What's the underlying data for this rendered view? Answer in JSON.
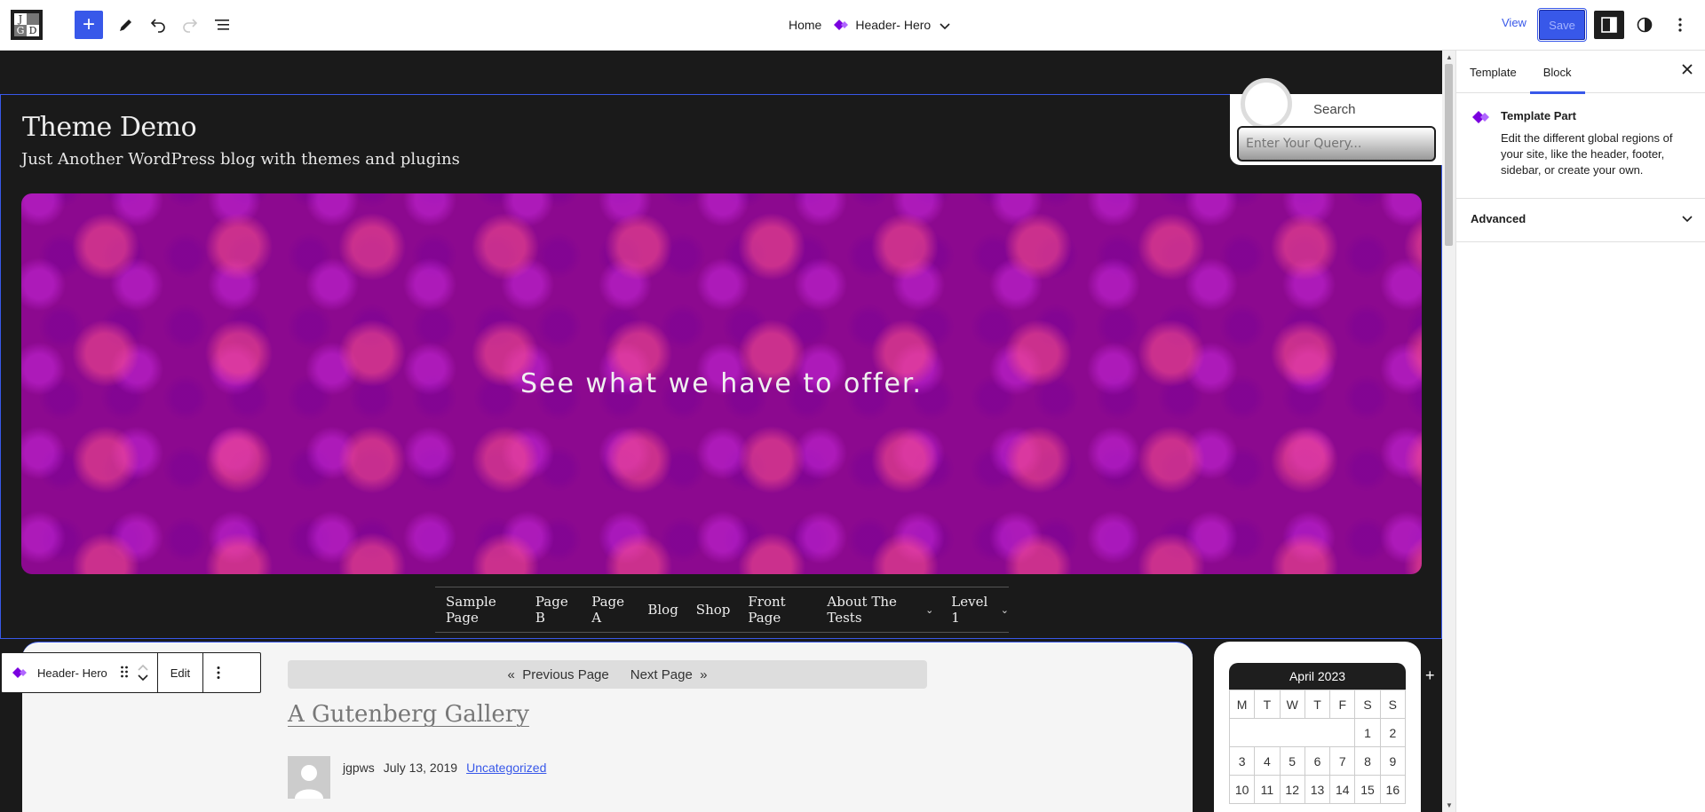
{
  "logo": {
    "letters": [
      "J",
      "",
      "G",
      "D"
    ]
  },
  "breadcrumb": {
    "home": "Home",
    "current": "Header- Hero"
  },
  "toolbar": {
    "view_label": "View",
    "save_label": "Save"
  },
  "site": {
    "title": "Theme Demo",
    "tagline": "Just Another WordPress blog with themes and plugins"
  },
  "search": {
    "label": "Search",
    "placeholder": "Enter Your Query..."
  },
  "hero": {
    "text": "See what we have to offer."
  },
  "nav": {
    "items": [
      "Sample Page",
      "Page B",
      "Page A",
      "Blog",
      "Shop",
      "Front Page",
      "About The Tests",
      "Level 1"
    ]
  },
  "block_toolbar": {
    "label": "Header- Hero",
    "edit_label": "Edit"
  },
  "pager": {
    "prev": "Previous Page",
    "next": "Next Page"
  },
  "post": {
    "title": "A Gutenberg Gallery",
    "author": "jgpws",
    "date": "July 13, 2019",
    "category": "Uncategorized"
  },
  "calendar": {
    "caption": "April 2023",
    "days": [
      "M",
      "T",
      "W",
      "T",
      "F",
      "S",
      "S"
    ],
    "rows": [
      [
        "",
        "",
        "",
        "",
        "",
        "1",
        "2"
      ],
      [
        "3",
        "4",
        "5",
        "6",
        "7",
        "8",
        "9"
      ],
      [
        "10",
        "11",
        "12",
        "13",
        "14",
        "15",
        "16"
      ]
    ]
  },
  "sidebar": {
    "tabs": [
      "Template",
      "Block"
    ],
    "card_title": "Template Part",
    "card_desc": "Edit the different global regions of your site, like the header, footer, sidebar, or create your own.",
    "advanced_label": "Advanced"
  },
  "colors": {
    "accent": "#3858e9",
    "hero": "#8c098f",
    "dark": "#1a1a1a",
    "template_part_icon": "#7a00df"
  }
}
